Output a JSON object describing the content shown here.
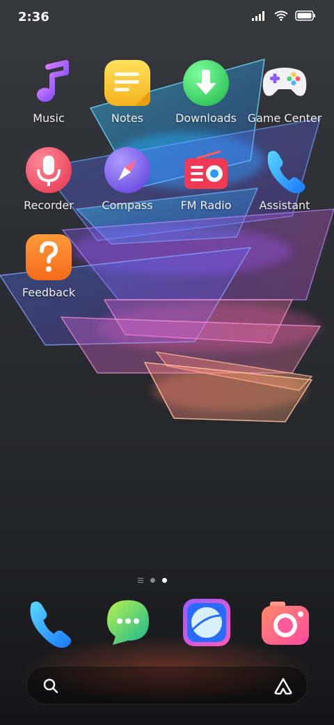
{
  "status_bar": {
    "time": "2:36"
  },
  "apps": [
    {
      "label": "Music",
      "icon": "music-note-icon"
    },
    {
      "label": "Notes",
      "icon": "notes-icon"
    },
    {
      "label": "Downloads",
      "icon": "download-arrow-icon"
    },
    {
      "label": "Game Center",
      "icon": "gamepad-icon"
    },
    {
      "label": "Recorder",
      "icon": "microphone-icon"
    },
    {
      "label": "Compass",
      "icon": "compass-icon"
    },
    {
      "label": "FM Radio",
      "icon": "radio-icon"
    },
    {
      "label": "Assistant",
      "icon": "phone-handset-icon"
    },
    {
      "label": "Feedback",
      "icon": "question-mark-icon"
    }
  ],
  "page_indicator": {
    "pages": 2,
    "current": 2
  },
  "dock": [
    {
      "icon": "phone-icon"
    },
    {
      "icon": "messages-icon"
    },
    {
      "icon": "browser-icon"
    },
    {
      "icon": "camera-icon"
    }
  ],
  "search_bar": {
    "left_icon": "search-icon",
    "right_icon": "assistant-logo-icon"
  }
}
